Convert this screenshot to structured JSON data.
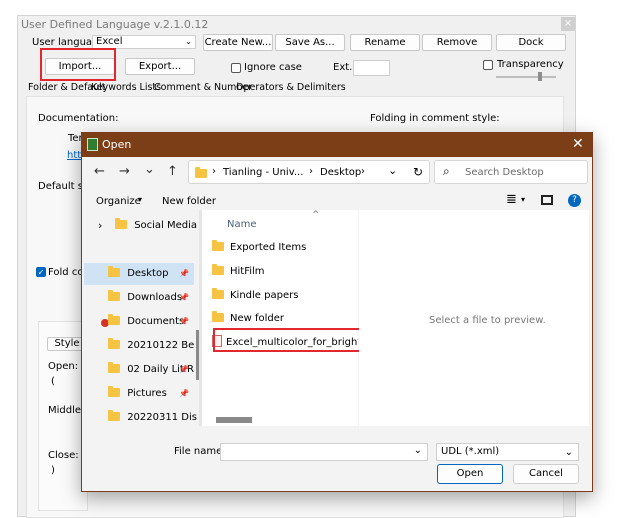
{
  "udl": {
    "title": "User Defined Language v.2.1.0.12",
    "close_glyph": "×",
    "user_language_label": "User language :",
    "user_language_value": "Excel",
    "buttons": {
      "create_new": "Create New...",
      "save_as": "Save As...",
      "rename": "Rename",
      "remove": "Remove",
      "dock": "Dock",
      "import": "Import...",
      "export": "Export..."
    },
    "ignore_case_label": "Ignore case",
    "ext_label": "Ext. :",
    "ext_value": "",
    "transparency_label": "Transparency",
    "tabs": [
      "Folder & Default",
      "Keywords Lists",
      "Comment & Number",
      "Operators & Delimiters"
    ],
    "documentation_label": "Documentation:",
    "folding_comment_label": "Folding in comment style:",
    "template_label": "Tem",
    "link_label": "http",
    "default_style_label": "Default style",
    "fold_compact_label": "Fold comp",
    "style_button": "Style",
    "open_label": "Open:",
    "open_value": "(",
    "middle_label": "Middle:",
    "close_label": "Close:",
    "close_value": ")"
  },
  "dialog": {
    "title": "Open",
    "close_glyph": "✕",
    "nav": {
      "back": "←",
      "forward": "→",
      "recent": "⌄",
      "up": "↑"
    },
    "address": {
      "segments": [
        "Tianling - Univ...",
        "Desktop"
      ],
      "separator": "›",
      "dropdown_glyph": "⌄",
      "refresh_glyph": "↻"
    },
    "search_placeholder": "Search Desktop",
    "search_glyph": "⌕",
    "organize_label": "Organize",
    "new_folder_label": "New folder",
    "view_glyph": "≣",
    "view_dropdown_glyph": "▾",
    "pane_glyph": "▭",
    "help_glyph": "?",
    "nav_items": [
      {
        "label": "Social Media A",
        "expander": "›",
        "pinned": false,
        "selected": false
      },
      {
        "label": "Desktop",
        "pinned": true,
        "selected": true
      },
      {
        "label": "Downloads",
        "pinned": true,
        "selected": false
      },
      {
        "label": "Documents",
        "pinned": true,
        "selected": false
      },
      {
        "label": "20210122 Be",
        "pinned": false,
        "selected": false
      },
      {
        "label": "02 Daily Lit R",
        "pinned": true,
        "selected": false
      },
      {
        "label": "Pictures",
        "pinned": true,
        "selected": false
      },
      {
        "label": "20220311 Dis",
        "pinned": false,
        "selected": false
      }
    ],
    "pin_glyph": "📌",
    "column_name": "Name",
    "sort_glyph": "^",
    "files": [
      {
        "name": "Exported Items",
        "type": "folder"
      },
      {
        "name": "HitFilm",
        "type": "folder"
      },
      {
        "name": "Kindle papers",
        "type": "folder"
      },
      {
        "name": "New folder",
        "type": "folder"
      },
      {
        "name": "Excel_multicolor_for_bright_the",
        "type": "xml"
      }
    ],
    "preview_text": "Select a file to preview.",
    "file_name_label": "File name:",
    "file_name_value": "",
    "file_type_value": "UDL (*.xml)",
    "open_button": "Open",
    "cancel_button": "Cancel",
    "accent_color": "#7c3e17",
    "highlight_color": "#e0282e"
  }
}
